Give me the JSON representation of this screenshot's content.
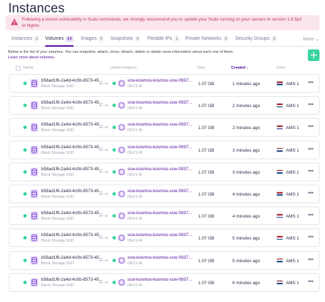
{
  "page": {
    "title": "Instances"
  },
  "alert": {
    "text": "Following a recent vulnerability in Sudo commands, we strongly recommend you to update your Sudo running on your servers to version 1.9.5p2 or higher."
  },
  "tabs": [
    {
      "label": "Instances",
      "count": "2",
      "active": false
    },
    {
      "label": "Volumes",
      "count": "14",
      "active": true
    },
    {
      "label": "Images",
      "count": "0",
      "active": false
    },
    {
      "label": "Snapshots",
      "count": "0",
      "active": false
    },
    {
      "label": "Flexible IPs",
      "count": "1",
      "active": false
    },
    {
      "label": "Private Networks",
      "count": "0",
      "active": false
    },
    {
      "label": "Security Groups",
      "count": "3",
      "active": false
    }
  ],
  "tabs_more": "More",
  "description": "Below is the list of your volumes. You can snapshot, attach, clone, detach, delete or obtain more information about each one of them.",
  "learn_more": "Learn more about volumes.",
  "add_button": "+",
  "columns": {
    "name": "Name",
    "linked_instance": "Linked Instance",
    "size": "Size",
    "created": "Created",
    "zone": "Zone"
  },
  "rows": [
    {
      "name": "b58ad1f6-2a4d-4c0b-8573-45...",
      "type": "Block Storage SSD",
      "instance": "scw-kosmos-kosmos-scw-0937...",
      "instance_type": "DEV1-M",
      "size": "1.07 GB",
      "created": "1 minutes ago",
      "zone": "AMS 1"
    },
    {
      "name": "b58ad1f6-2a4d-4c0b-8573-45...",
      "type": "Block Storage SSD",
      "instance": "scw-kosmos-kosmos-scw-0937...",
      "instance_type": "DEV1-M",
      "size": "1.07 GB",
      "created": "2 minutes ago",
      "zone": "AMS 1"
    },
    {
      "name": "b58ad1f6-2a4d-4c0b-8573-45...",
      "type": "Block Storage SSD",
      "instance": "scw-kosmos-kosmos-scw-0937...",
      "instance_type": "DEV1-M",
      "size": "1.07 GB",
      "created": "2 minutes ago",
      "zone": "AMS 1"
    },
    {
      "name": "b58ad1f6-2a4d-4c0b-8573-45...",
      "type": "Block Storage SSD",
      "instance": "scw-kosmos-kosmos-scw-0937...",
      "instance_type": "DEV1-M",
      "size": "1.07 GB",
      "created": "3 minutes ago",
      "zone": "AMS 1"
    },
    {
      "name": "b58ad1f6-2a4d-4c0b-8573-45...",
      "type": "Block Storage SSD",
      "instance": "scw-kosmos-kosmos-scw-0937...",
      "instance_type": "DEV1-M",
      "size": "1.07 GB",
      "created": "3 minutes ago",
      "zone": "AMS 1"
    },
    {
      "name": "b58ad1f6-2a4d-4c0b-8573-45...",
      "type": "Block Storage SSD",
      "instance": "scw-kosmos-kosmos-scw-0937...",
      "instance_type": "DEV1-M",
      "size": "1.07 GB",
      "created": "4 minutes ago",
      "zone": "AMS 1"
    },
    {
      "name": "b58ad1f6-2a4d-4c0b-8573-45...",
      "type": "Block Storage SSD",
      "instance": "scw-kosmos-kosmos-scw-0937...",
      "instance_type": "DEV1-M",
      "size": "1.07 GB",
      "created": "4 minutes ago",
      "zone": "AMS 1"
    },
    {
      "name": "b58ad1f6-2a4d-4c0b-8573-45...",
      "type": "Block Storage SSD",
      "instance": "scw-kosmos-kosmos-scw-0937...",
      "instance_type": "DEV1-M",
      "size": "1.07 GB",
      "created": "5 minutes ago",
      "zone": "AMS 1"
    },
    {
      "name": "b58ad1f6-2a4d-4c0b-8573-45...",
      "type": "Block Storage SSD",
      "instance": "scw-kosmos-kosmos-scw-0937...",
      "instance_type": "DEV1-M",
      "size": "1.07 GB",
      "created": "5 minutes ago",
      "zone": "AMS 1"
    },
    {
      "name": "b58ad1f6-2a4d-4c0b-8573-45...",
      "type": "Block Storage SSD",
      "instance": "scw-kosmos-kosmos-scw-0937...",
      "instance_type": "DEV1-M",
      "size": "1.07 GB",
      "created": "6 minutes ago",
      "zone": "AMS 1"
    }
  ],
  "colors": {
    "accent": "#4f0599",
    "status_green": "#38d39e",
    "alert_bg": "#fbe5ec",
    "alert_text": "#b83a64"
  },
  "icons": {
    "alert": "warning-triangle-icon",
    "volume": "volume-storage-icon",
    "link": "link-icon",
    "instance": "instance-chip-icon",
    "zone_flag": "netherlands-flag-icon",
    "more": "more-dots-icon"
  }
}
